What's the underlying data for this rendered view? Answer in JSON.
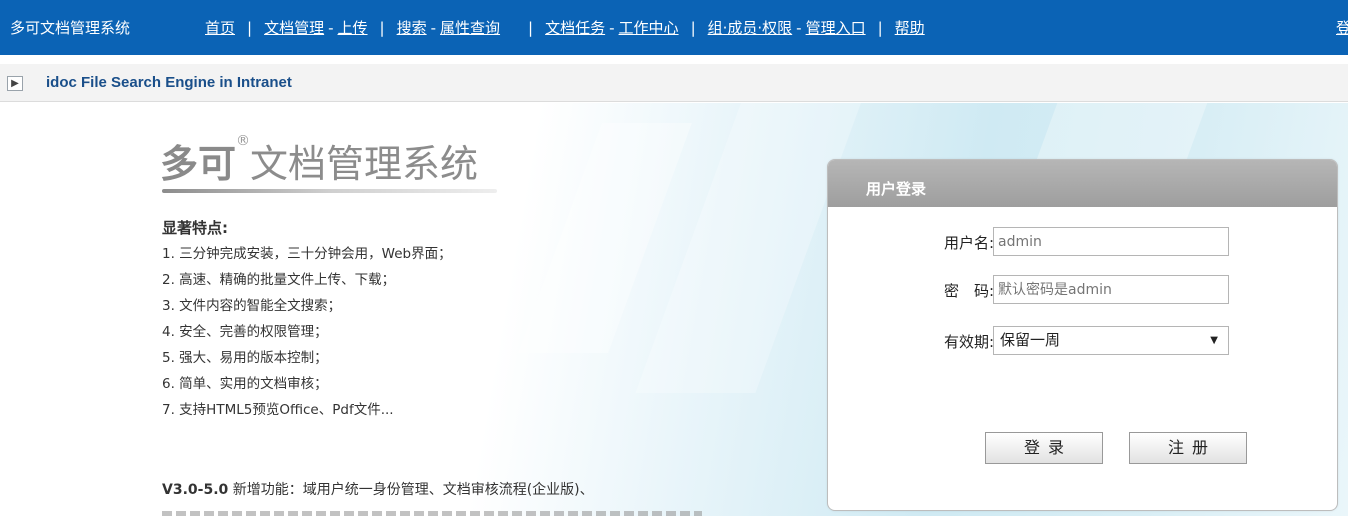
{
  "topbar": {
    "system_name": "多可文档管理系统",
    "nav": [
      {
        "label": "首页"
      },
      {
        "label": "文档管理",
        "sub": "上传"
      },
      {
        "label": "搜索",
        "sub": "属性查询"
      },
      {
        "label": "文档任务",
        "sub": "工作中心"
      },
      {
        "label": "组·成员·权限",
        "sub": "管理入口"
      },
      {
        "label": "帮助"
      }
    ],
    "right_partial": "登",
    "bg_color": "#0b63b5"
  },
  "subbar": {
    "toggle_icon": "expand-arrow-icon",
    "title": "idoc File Search Engine in Intranet"
  },
  "logo": {
    "brand": "多可",
    "reg": "®",
    "rest": "文档管理系统"
  },
  "features": {
    "heading": "显著特点:",
    "items": [
      "1. 三分钟完成安装，三十分钟会用，Web界面；",
      "2. 高速、精确的批量文件上传、下载；",
      "3. 文件内容的智能全文搜索；",
      "4. 安全、完善的权限管理；",
      "5. 强大、易用的版本控制；",
      "6. 简单、实用的文档审核；",
      "7. 支持HTML5预览Office、Pdf文件..."
    ],
    "new_version": "V3.0-5.0",
    "new_text": " 新增功能：域用户统一身份管理、文档审核流程(企业版)、"
  },
  "login": {
    "title": "用户登录",
    "username_label": "用户名:",
    "username_placeholder": "admin",
    "password_label": "密　码:",
    "password_placeholder": "默认密码是admin",
    "validity_label": "有效期:",
    "validity_value": "保留一周",
    "login_button": "登录",
    "register_button": "注册"
  }
}
